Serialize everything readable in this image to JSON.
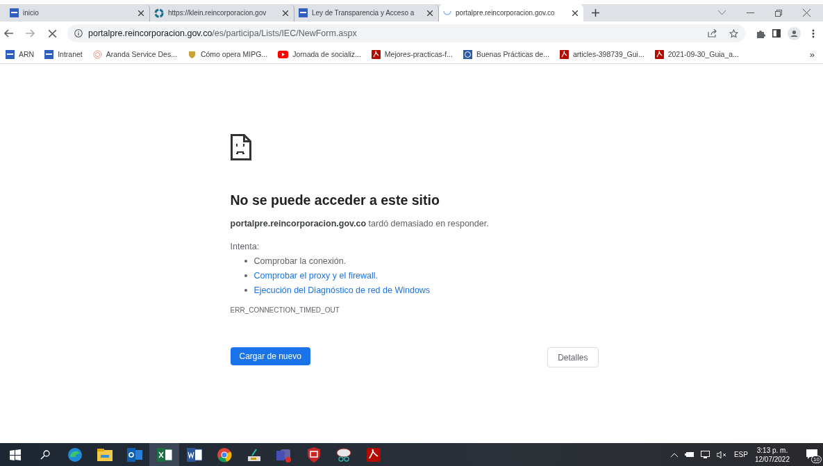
{
  "tabs": [
    {
      "kind": "arn",
      "title": "inicio",
      "selected": false
    },
    {
      "kind": "klein",
      "title": "https://klein.reincorporacion.gov",
      "selected": false
    },
    {
      "kind": "arn",
      "title": "Ley de Transparencia y Acceso a",
      "selected": false
    },
    {
      "kind": "loading",
      "title": "portalpre.reincorporacion.gov.co",
      "selected": true
    }
  ],
  "address": {
    "host": "portalpre.reincorporacion.gov.co",
    "path": "/es/participa/Lists/IEC/NewForm.aspx"
  },
  "bookmarks": [
    {
      "kind": "arn",
      "label": "ARN"
    },
    {
      "kind": "arn",
      "label": "Intranet"
    },
    {
      "kind": "aranda",
      "label": "Aranda Service Des..."
    },
    {
      "kind": "crest",
      "label": "Cómo opera MIPG..."
    },
    {
      "kind": "video",
      "label": "Jornada de socializ..."
    },
    {
      "kind": "pdf",
      "label": "Mejores-practicas-f..."
    },
    {
      "kind": "globe",
      "label": "Buenas Prácticas de..."
    },
    {
      "kind": "pdf",
      "label": "articles-398739_Gui..."
    },
    {
      "kind": "pdf",
      "label": "2021-09-30_Guia_a..."
    }
  ],
  "bookmarks_more": "»",
  "error": {
    "heading": "No se puede acceder a este sitio",
    "message": "**portalpre.reincorporacion.gov.co** tardó demasiado en responder.",
    "try_label": "Intenta:",
    "suggestions": [
      {
        "kind": "text",
        "text": "Comprobar la conexión."
      },
      {
        "kind": "link",
        "text": "Comprobar el proxy y el firewall."
      },
      {
        "kind": "link",
        "text": "Ejecución del Diagnóstico de red de Windows"
      }
    ],
    "code": "ERR_CONNECTION_TIMED_OUT",
    "reload_button": "Cargar de nuevo",
    "details_button": "Detalles"
  },
  "taskbar": {
    "apps": [
      {
        "kind": "edge",
        "active": false
      },
      {
        "kind": "files",
        "active": false
      },
      {
        "kind": "mail",
        "active": false
      },
      {
        "kind": "sheet",
        "active": true
      },
      {
        "kind": "doc",
        "active": false
      },
      {
        "kind": "chrome",
        "active": false
      },
      {
        "kind": "scanner",
        "active": false
      },
      {
        "kind": "teams",
        "active": false
      },
      {
        "kind": "shield",
        "active": false
      },
      {
        "kind": "snip",
        "active": false
      },
      {
        "kind": "pdf",
        "active": false
      }
    ],
    "language": "ESP",
    "time": "3:13 p. m.",
    "date": "12/07/2022",
    "notifications": "10"
  }
}
